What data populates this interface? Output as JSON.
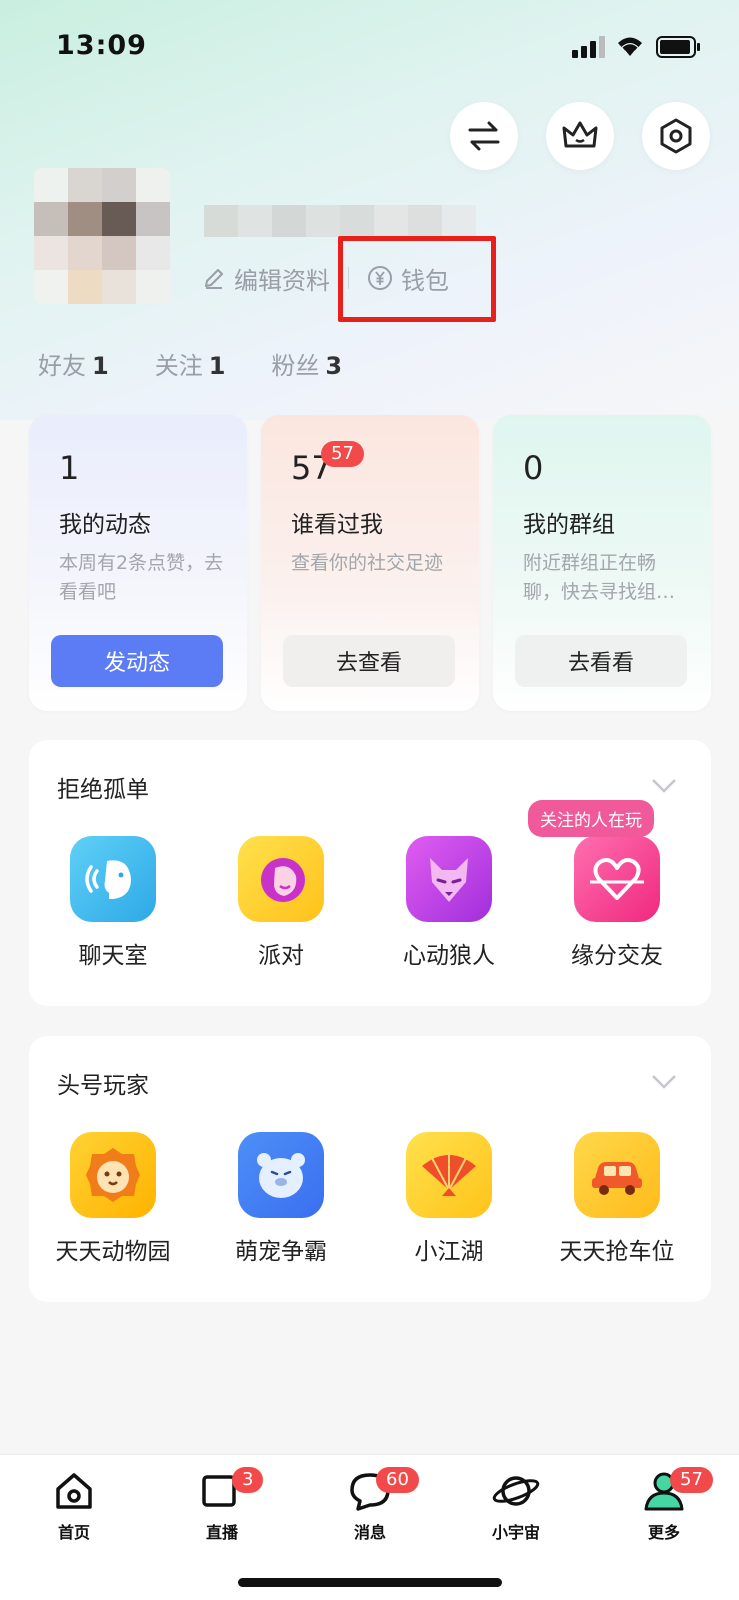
{
  "status": {
    "time": "13:09"
  },
  "profile": {
    "edit_label": "编辑资料",
    "wallet_label": "钱包"
  },
  "stats": [
    {
      "label": "好友",
      "value": "1"
    },
    {
      "label": "关注",
      "value": "1"
    },
    {
      "label": "粉丝",
      "value": "3"
    }
  ],
  "cards": [
    {
      "count": "1",
      "title": "我的动态",
      "desc": "本周有2条点赞，去看看吧",
      "action": "发动态",
      "badge": ""
    },
    {
      "count": "57",
      "title": "谁看过我",
      "desc": "查看你的社交足迹",
      "action": "去查看",
      "badge": "57"
    },
    {
      "count": "0",
      "title": "我的群组",
      "desc": "附近群组正在畅聊，快去寻找组…",
      "action": "去看看",
      "badge": ""
    }
  ],
  "section1": {
    "title": "拒绝孤单",
    "tag": "关注的人在玩",
    "apps": [
      {
        "label": "聊天室",
        "icon": "chat-room-icon"
      },
      {
        "label": "派对",
        "icon": "party-icon"
      },
      {
        "label": "心动狼人",
        "icon": "werewolf-icon"
      },
      {
        "label": "缘分交友",
        "icon": "heart-friend-icon"
      }
    ]
  },
  "section2": {
    "title": "头号玩家",
    "apps": [
      {
        "label": "天天动物园",
        "icon": "lion-icon"
      },
      {
        "label": "萌宠争霸",
        "icon": "bear-icon"
      },
      {
        "label": "小江湖",
        "icon": "fan-icon"
      },
      {
        "label": "天天抢车位",
        "icon": "car-icon"
      }
    ]
  },
  "tabbar": [
    {
      "label": "首页",
      "badge": ""
    },
    {
      "label": "直播",
      "badge": "3"
    },
    {
      "label": "消息",
      "badge": "60"
    },
    {
      "label": "小宇宙",
      "badge": ""
    },
    {
      "label": "更多",
      "badge": "57"
    }
  ],
  "colors": {
    "accent": "#5b7cf5",
    "badge": "#f24a4a",
    "highlight": "#e8201c"
  }
}
